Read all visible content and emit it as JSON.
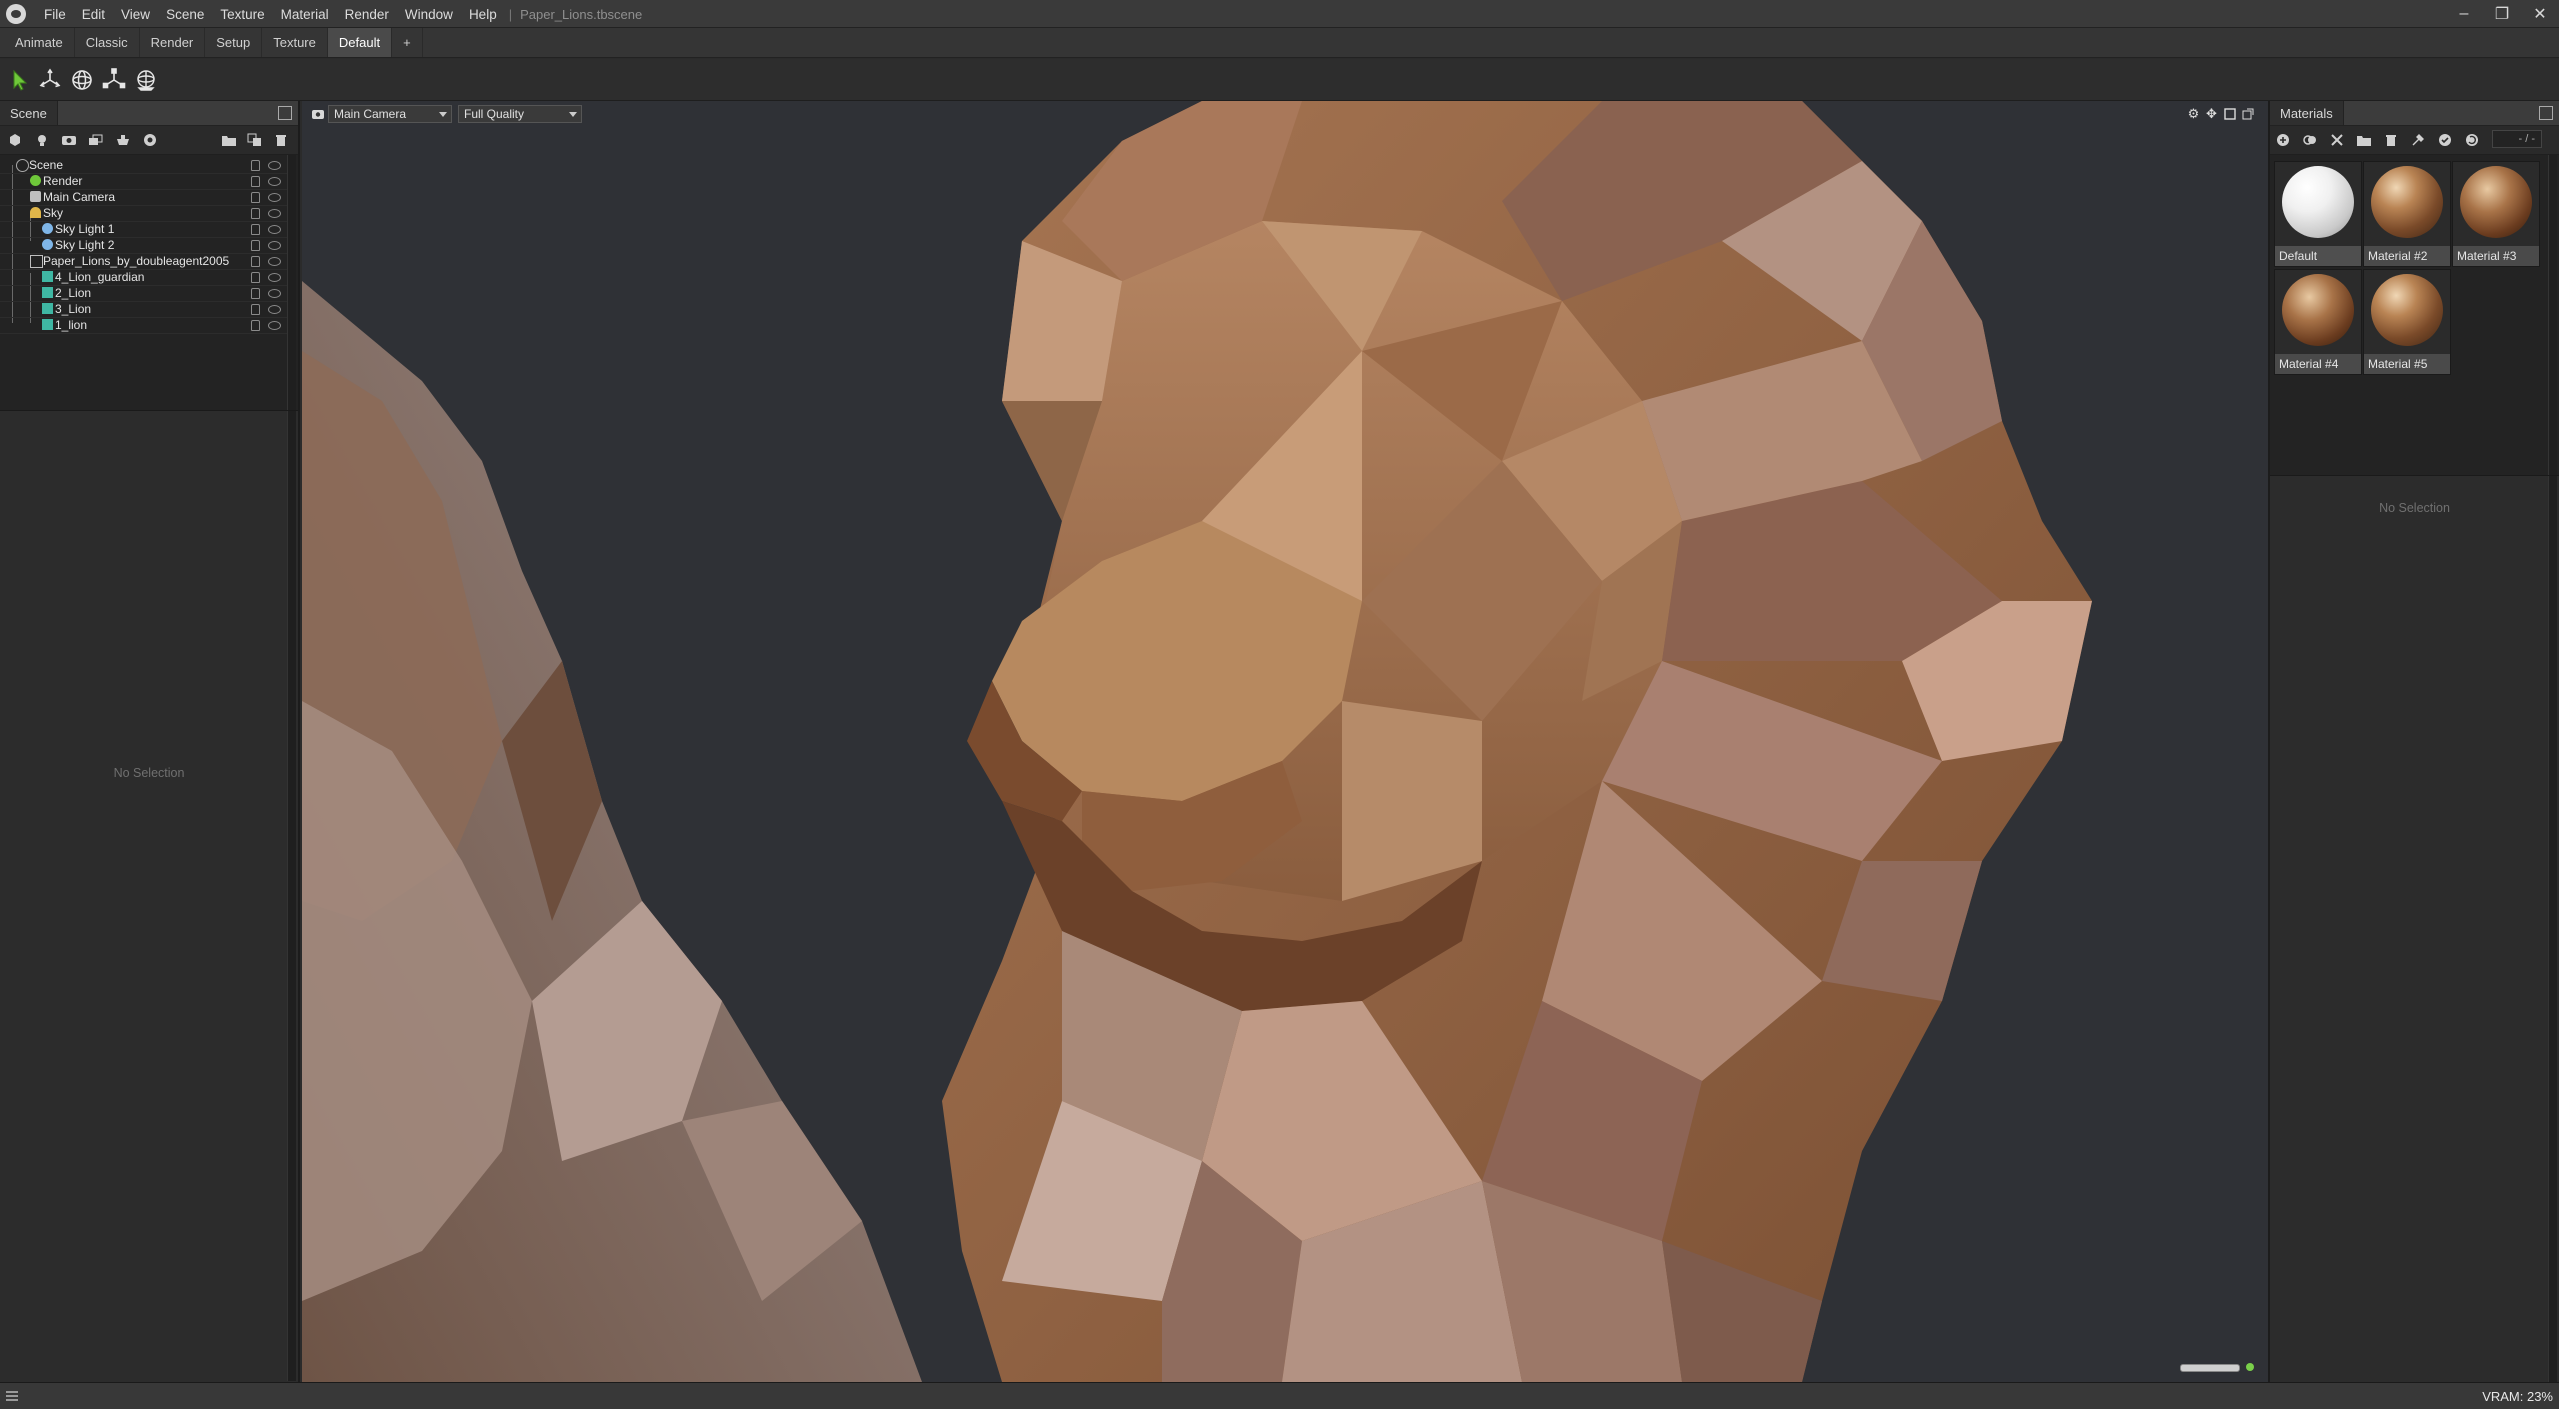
{
  "app": {
    "menu": [
      "File",
      "Edit",
      "View",
      "Scene",
      "Texture",
      "Material",
      "Render",
      "Window",
      "Help"
    ],
    "separator": "|",
    "document_title": "Paper_Lions.tbscene",
    "window_controls": [
      "–",
      "❐",
      "✕"
    ]
  },
  "workspace_tabs": {
    "items": [
      "Animate",
      "Classic",
      "Render",
      "Setup",
      "Texture",
      "Default",
      "+"
    ],
    "active": "Default"
  },
  "toolbar": {
    "tools": [
      "select-tool-icon",
      "move-tool-icon",
      "rotate-tool-icon",
      "scale-tool-icon",
      "world-tool-icon"
    ]
  },
  "scene_panel": {
    "tab": "Scene",
    "tree": [
      {
        "label": "Scene",
        "icon": "scene-icon"
      },
      {
        "label": "Render",
        "icon": "render-icon"
      },
      {
        "label": "Main Camera",
        "icon": "camera-icon"
      },
      {
        "label": "Sky",
        "icon": "sky-icon"
      },
      {
        "label": "Sky Light 1",
        "icon": "light-icon"
      },
      {
        "label": "Sky Light 2",
        "icon": "light-icon"
      },
      {
        "label": "Paper_Lions_by_doubleagent2005",
        "icon": "object-icon"
      },
      {
        "label": "4_Lion_guardian",
        "icon": "mesh-icon"
      },
      {
        "label": "2_Lion",
        "icon": "mesh-icon"
      },
      {
        "label": "3_Lion",
        "icon": "mesh-icon"
      },
      {
        "label": "1_lion",
        "icon": "mesh-icon"
      }
    ],
    "no_selection": "No Selection"
  },
  "viewport": {
    "camera": "Main Camera",
    "quality": "Full Quality"
  },
  "materials_panel": {
    "tab": "Materials",
    "page": "- / -",
    "materials": [
      {
        "label": "Default",
        "swatch": "white"
      },
      {
        "label": "Material #2",
        "swatch": "marble"
      },
      {
        "label": "Material #3",
        "swatch": "marble"
      },
      {
        "label": "Material #4",
        "swatch": "marble"
      },
      {
        "label": "Material #5",
        "swatch": "marble"
      }
    ],
    "no_selection": "No Selection"
  },
  "status": {
    "vram": "VRAM: 23%"
  },
  "colors": {
    "accent_green": "#7ad04a",
    "teal_mesh": "#3fb7a3",
    "viewport_bg": "#2f3136",
    "lion_paper": "#9a6a48"
  }
}
